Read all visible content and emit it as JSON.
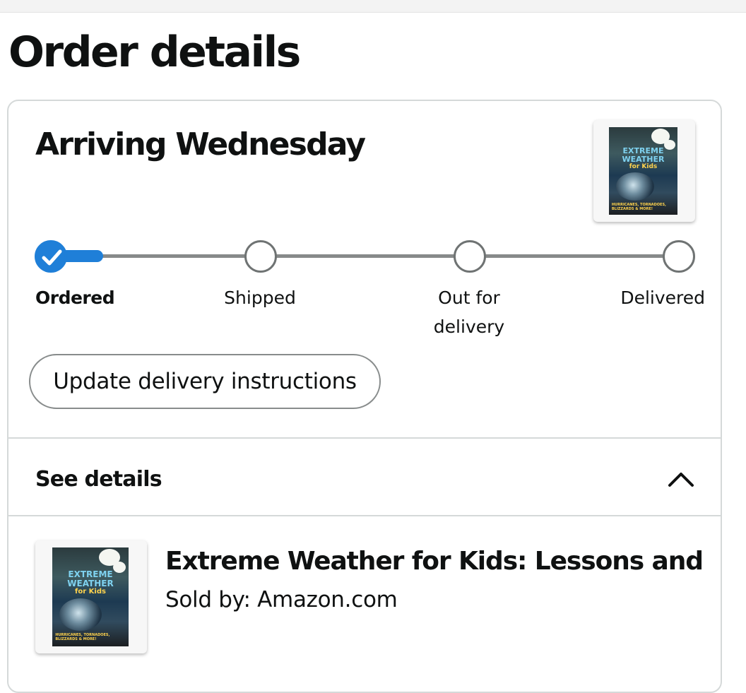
{
  "page": {
    "title": "Order details"
  },
  "shipment": {
    "status_heading": "Arriving Wednesday",
    "tracker": {
      "current_step_index": 0,
      "steps": [
        {
          "label": "Ordered",
          "completed": true
        },
        {
          "label": "Shipped",
          "completed": false
        },
        {
          "label": "Out for\ndelivery",
          "completed": false
        },
        {
          "label": "Delivered",
          "completed": false
        }
      ]
    },
    "update_button_label": "Update delivery instructions",
    "see_details_label": "See details",
    "details_expanded": true
  },
  "item": {
    "title": "Extreme Weather for Kids: Lessons and...",
    "sold_by": "Sold by: Amazon.com",
    "cover": {
      "title_line1": "EXTREME",
      "title_line2": "WEATHER",
      "title_line3": "for Kids"
    }
  },
  "colors": {
    "progress_accent": "#1f7fd8",
    "track_gray": "#878a8a",
    "border": "#d5d9d9"
  },
  "icons": {
    "completed_step": "check-icon",
    "collapse": "chevron-up-icon"
  }
}
